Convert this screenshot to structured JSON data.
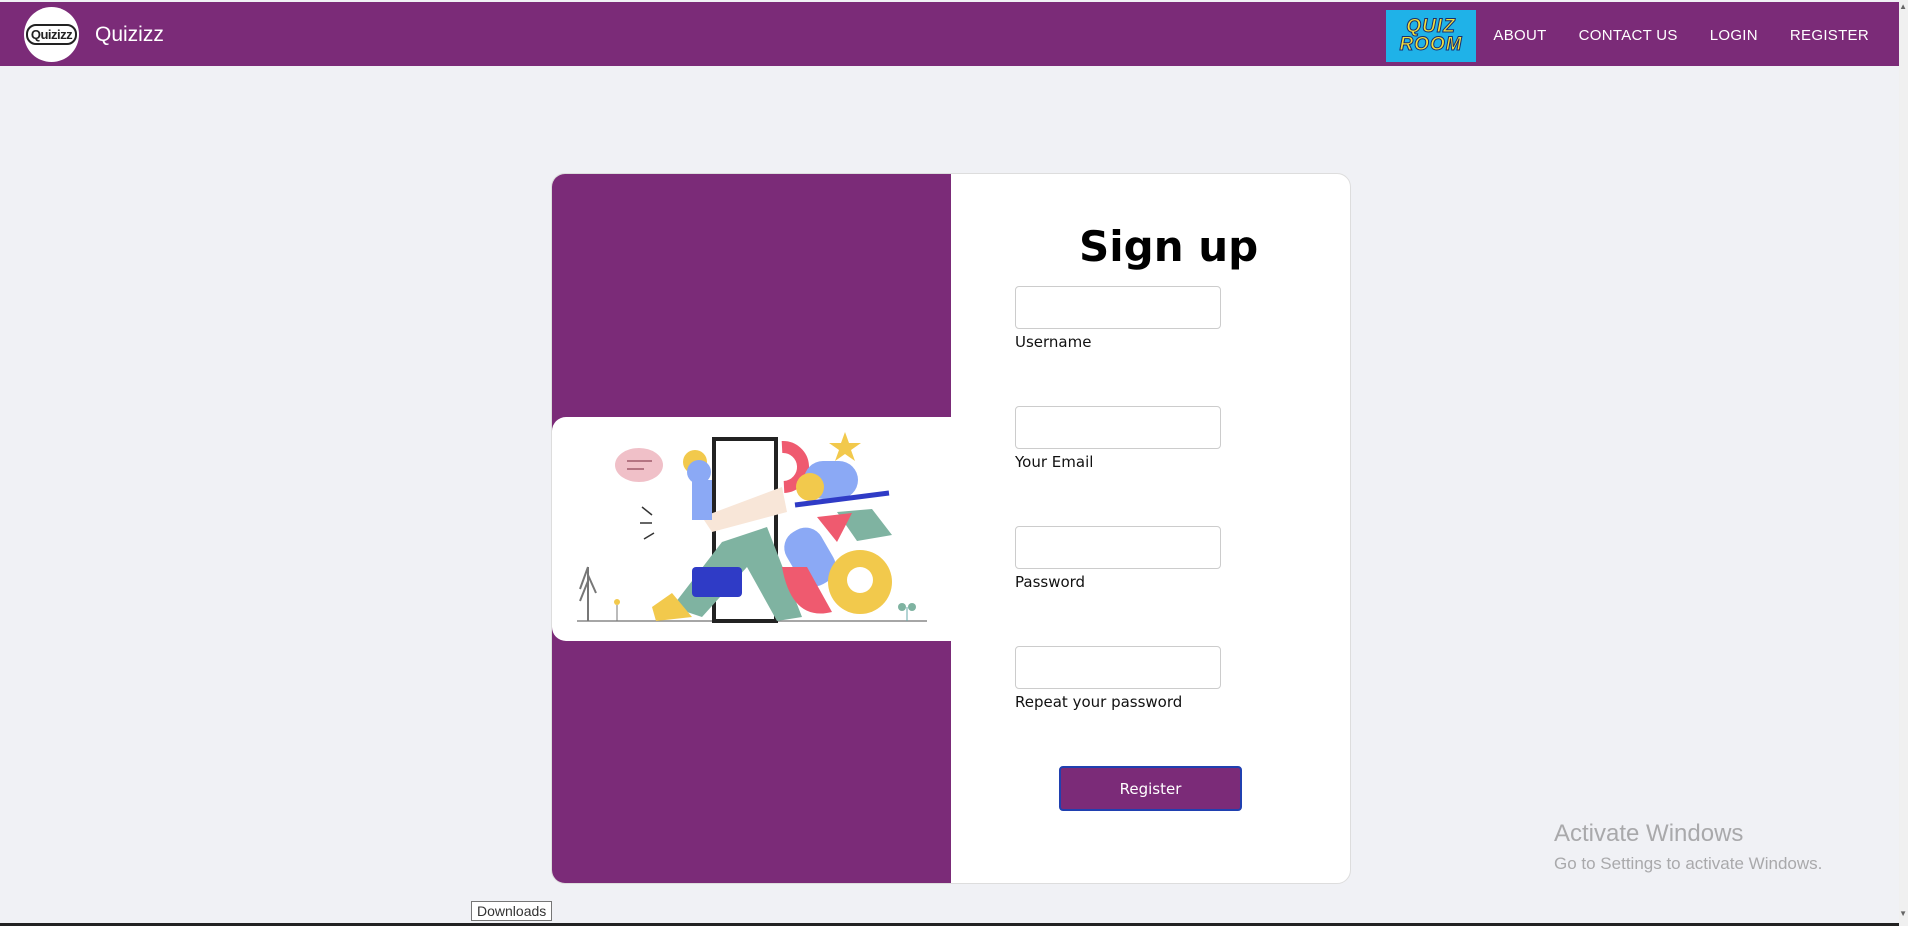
{
  "nav": {
    "brand_logo_text": "Quizizz",
    "brand_name": "Quizizz",
    "quizroom_line1": "QUIZ",
    "quizroom_line2": "ROOM",
    "links": [
      "ABOUT",
      "CONTACT US",
      "LOGIN",
      "REGISTER"
    ]
  },
  "form": {
    "title": "Sign up",
    "fields": [
      {
        "label": "Username",
        "value": ""
      },
      {
        "label": "Your Email",
        "value": ""
      },
      {
        "label": "Password",
        "value": ""
      },
      {
        "label": "Repeat your password",
        "value": ""
      }
    ],
    "submit_label": "Register"
  },
  "os": {
    "activate_title": "Activate Windows",
    "activate_subtitle": "Go to Settings to activate Windows.",
    "downloads_tooltip": "Downloads"
  },
  "colors": {
    "brand_purple": "#7b2b78",
    "page_bg": "#f0f1f5"
  }
}
